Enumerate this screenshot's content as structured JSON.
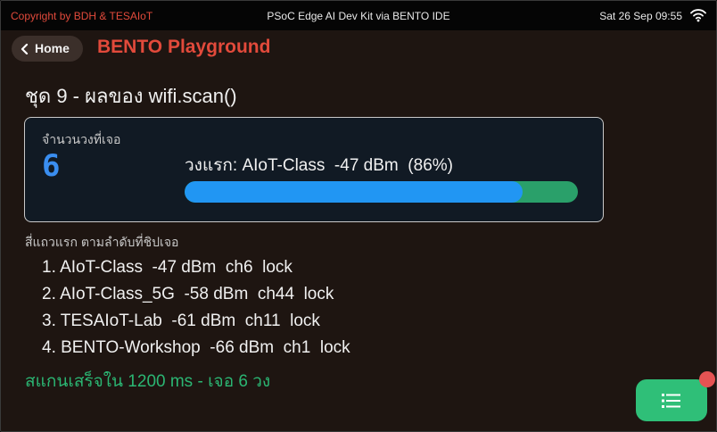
{
  "statusbar": {
    "copyright": "Copyright by BDH & TESAIoT",
    "title": "PSoC Edge AI Dev Kit via BENTO IDE",
    "datetime": "Sat 26 Sep 09:55",
    "wifi_icon": "wifi-icon"
  },
  "nav": {
    "home_label": "Home",
    "back_icon": "chevron-left-icon",
    "app_title": "BENTO Playground"
  },
  "page": {
    "title": "ชุด 9 - ผลของ wifi.scan()"
  },
  "card": {
    "count_label": "จำนวนวงที่เจอ",
    "count": "6",
    "best_text": "วงแรก: AIoT-Class  -47 dBm  (86%)",
    "signal_percent": 86,
    "colors": {
      "fill": "#2196f3",
      "track": "#2aa06a"
    }
  },
  "list": {
    "label": "สี่แถวแรก ตามลำดับที่ชิปเจอ",
    "items": [
      "1. AIoT-Class  -47 dBm  ch6  lock",
      "2. AIoT-Class_5G  -58 dBm  ch44  lock",
      "3. TESAIoT-Lab  -61 dBm  ch11  lock",
      "4. BENTO-Workshop  -66 dBm  ch1  lock"
    ]
  },
  "summary": "สแกนเสร็จใน 1200 ms - เจอ 6 วง",
  "fab": {
    "icon": "menu-list-icon",
    "badge_color": "#e55353"
  },
  "colors": {
    "accent": "#e24a3b",
    "success": "#2bb673",
    "count": "#3a8ef0"
  }
}
